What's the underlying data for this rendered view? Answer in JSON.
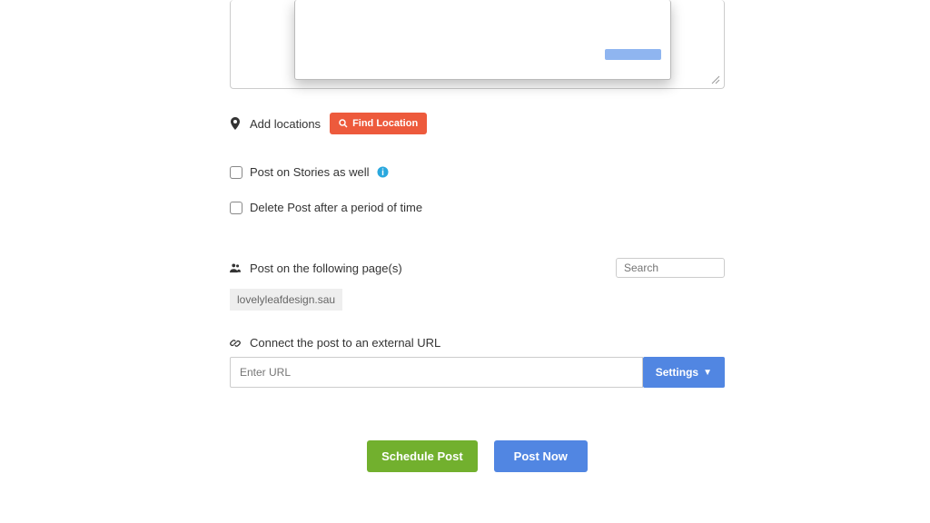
{
  "locations": {
    "add_label": "Add locations",
    "find_button": "Find Location"
  },
  "checkboxes": {
    "stories_label": "Post on Stories as well",
    "delete_label": "Delete Post after a period of time"
  },
  "pages": {
    "heading": "Post on the following page(s)",
    "search_placeholder": "Search",
    "tag": "lovelyleafdesign.sau"
  },
  "external_url": {
    "heading": "Connect the post to an external URL",
    "placeholder": "Enter URL",
    "settings_label": "Settings"
  },
  "actions": {
    "schedule": "Schedule Post",
    "post_now": "Post Now"
  }
}
